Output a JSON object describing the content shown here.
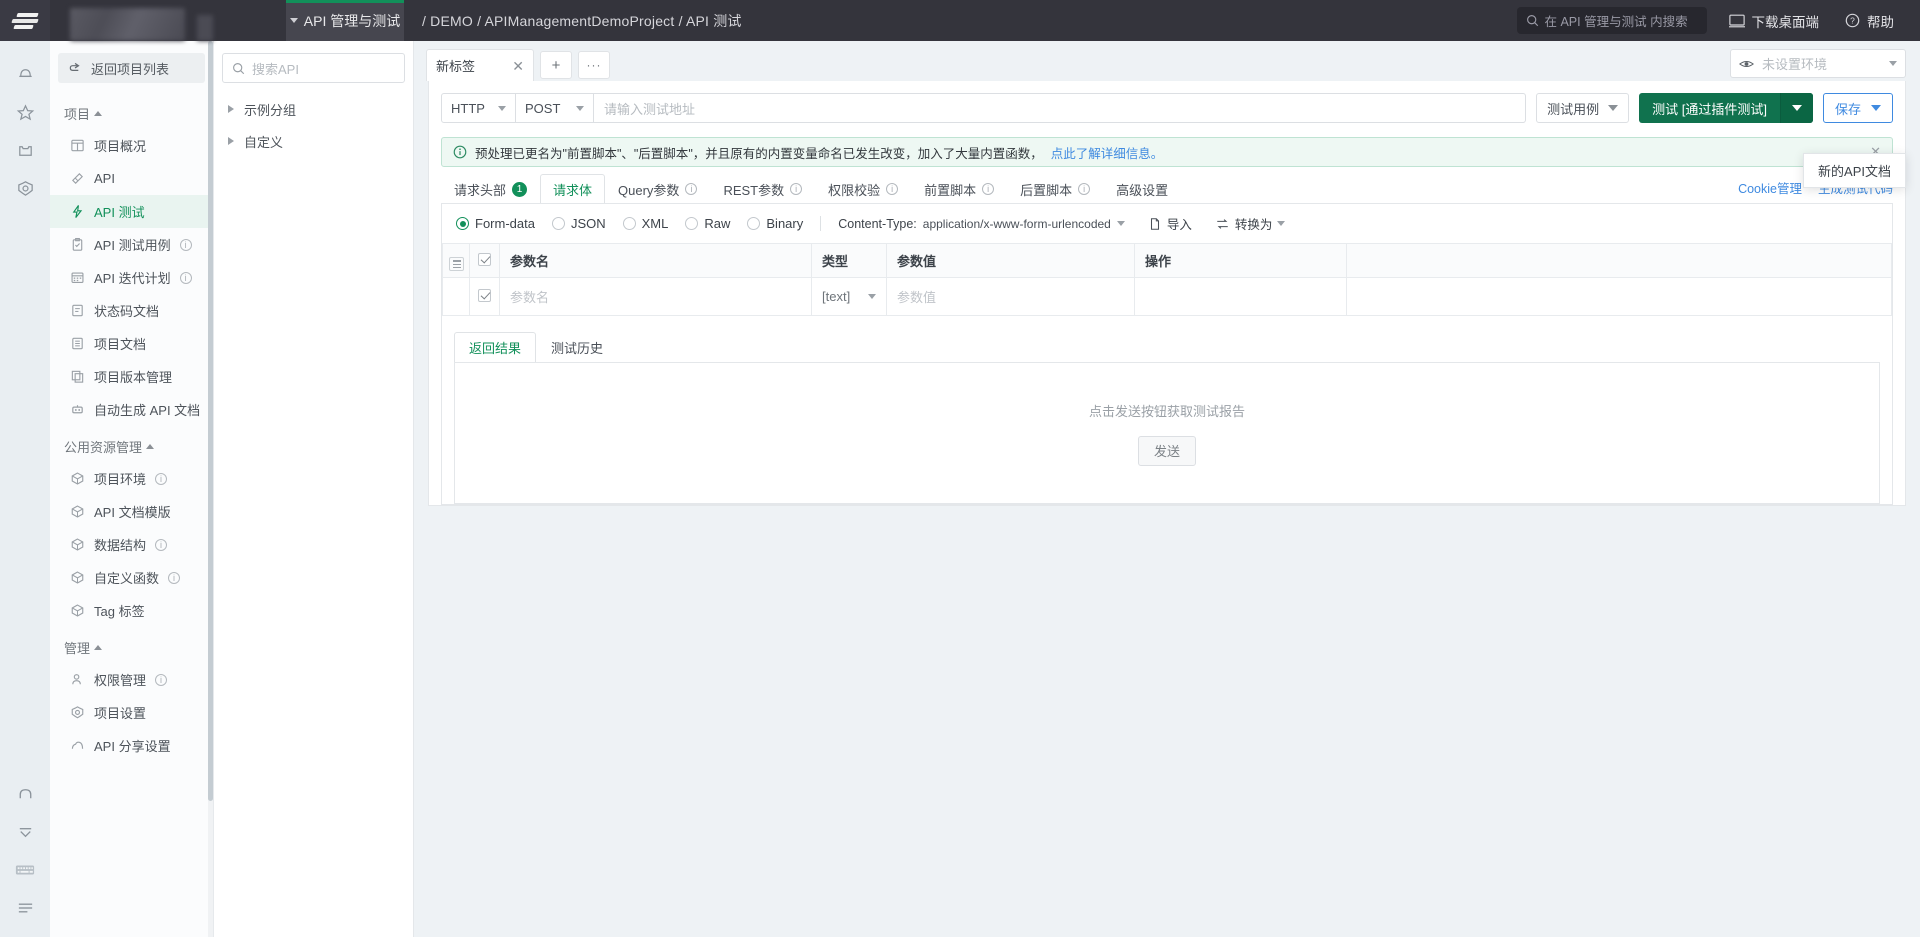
{
  "topbar": {
    "module_tab": "API 管理与测试",
    "breadcrumb": "/ DEMO / APIManagementDemoProject / API 测试",
    "search_placeholder": "在 API 管理与测试 内搜索",
    "download_label": "下载桌面端",
    "help_label": "帮助"
  },
  "rail": {
    "icons": [
      "bell-icon",
      "star-icon",
      "box-icon",
      "gear-icon"
    ],
    "bottom_icons": [
      "headset-icon",
      "collapse-icon",
      "keyboard-icon",
      "menu-icon"
    ]
  },
  "sidenav": {
    "back_label": "返回项目列表",
    "groups": [
      {
        "title": "项目",
        "items": [
          {
            "label": "项目概况",
            "icon": "overview-icon",
            "info": false,
            "active": false
          },
          {
            "label": "API",
            "icon": "api-icon",
            "info": false,
            "active": false
          },
          {
            "label": "API 测试",
            "icon": "lightning-icon",
            "info": false,
            "active": true
          },
          {
            "label": "API 测试用例",
            "icon": "clipboard-icon",
            "info": true,
            "active": false
          },
          {
            "label": "API 迭代计划",
            "icon": "calendar-icon",
            "info": true,
            "active": false
          },
          {
            "label": "状态码文档",
            "icon": "doc-icon",
            "info": false,
            "active": false
          },
          {
            "label": "项目文档",
            "icon": "book-icon",
            "info": false,
            "active": false
          },
          {
            "label": "项目版本管理",
            "icon": "copy-icon",
            "info": false,
            "active": false
          },
          {
            "label": "自动生成 API 文档",
            "icon": "robot-icon",
            "info": false,
            "active": false
          }
        ]
      },
      {
        "title": "公用资源管理",
        "items": [
          {
            "label": "项目环境",
            "icon": "cube-icon",
            "info": true,
            "active": false
          },
          {
            "label": "API 文档模版",
            "icon": "cube-icon",
            "info": false,
            "active": false
          },
          {
            "label": "数据结构",
            "icon": "cube-icon",
            "info": true,
            "active": false
          },
          {
            "label": "自定义函数",
            "icon": "cube-icon",
            "info": true,
            "active": false
          },
          {
            "label": "Tag 标签",
            "icon": "cube-icon",
            "info": false,
            "active": false
          }
        ]
      },
      {
        "title": "管理",
        "items": [
          {
            "label": "权限管理",
            "icon": "people-icon",
            "info": true,
            "active": false
          },
          {
            "label": "项目设置",
            "icon": "gear-icon",
            "info": false,
            "active": false
          },
          {
            "label": "API 分享设置",
            "icon": "cloud-icon",
            "info": false,
            "active": false
          }
        ]
      }
    ]
  },
  "apipanel": {
    "search_placeholder": "搜索API",
    "tree": [
      {
        "label": "示例分组"
      },
      {
        "label": "自定义"
      }
    ]
  },
  "main": {
    "doc_tab": "新标签",
    "add_tab_label": "+",
    "more_tab_label": "···",
    "env": {
      "placeholder": "未设置环境",
      "eye_icon": "eye-icon"
    },
    "url_row": {
      "protocol": "HTTP",
      "method": "POST",
      "url_placeholder": "请输入测试地址",
      "url_value": "",
      "testcase_label": "测试用例",
      "test_label": "测试 [通过插件测试]",
      "save_label": "保存"
    },
    "save_menu": {
      "item": "新的API文档"
    },
    "alert": {
      "text": "预处理已更名为\"前置脚本\"、\"后置脚本\"，并且原有的内置变量命名已发生改变，加入了大量内置函数，",
      "link": "点此了解详细信息。",
      "icon": "info-circle-icon"
    },
    "subtabs": [
      {
        "label": "请求头部",
        "badge": "1",
        "info": false,
        "active": false
      },
      {
        "label": "请求体",
        "badge": "",
        "info": false,
        "active": true
      },
      {
        "label": "Query参数",
        "badge": "",
        "info": true,
        "active": false
      },
      {
        "label": "REST参数",
        "badge": "",
        "info": true,
        "active": false
      },
      {
        "label": "权限校验",
        "badge": "",
        "info": true,
        "active": false
      },
      {
        "label": "前置脚本",
        "badge": "",
        "info": true,
        "active": false
      },
      {
        "label": "后置脚本",
        "badge": "",
        "info": true,
        "active": false
      },
      {
        "label": "高级设置",
        "badge": "",
        "info": false,
        "active": false
      }
    ],
    "right_links": [
      "Cookie管理",
      "生成测试代码"
    ],
    "body_types": [
      {
        "label": "Form-data",
        "selected": true
      },
      {
        "label": "JSON",
        "selected": false
      },
      {
        "label": "XML",
        "selected": false
      },
      {
        "label": "Raw",
        "selected": false
      },
      {
        "label": "Binary",
        "selected": false
      }
    ],
    "content_type_label": "Content-Type:",
    "content_type_value": "application/x-www-form-urlencoded",
    "import_label": "导入",
    "convert_label": "转换为",
    "params_table": {
      "headers": [
        "",
        "",
        "参数名",
        "类型",
        "参数值",
        "操作",
        ""
      ],
      "rows": [
        {
          "checked": true,
          "name": "",
          "name_placeholder": "参数名",
          "type": "[text]",
          "value": "",
          "value_placeholder": "参数值",
          "op": ""
        }
      ]
    },
    "response": {
      "tabs": [
        {
          "label": "返回结果",
          "active": true
        },
        {
          "label": "测试历史",
          "active": false
        }
      ],
      "hint": "点击发送按钮获取测试报告",
      "send_label": "发送"
    }
  },
  "colors": {
    "brand_green": "#12905a",
    "test_button": "#10724e",
    "link_blue": "#3f8ae0",
    "topbar_bg": "#34343c"
  }
}
